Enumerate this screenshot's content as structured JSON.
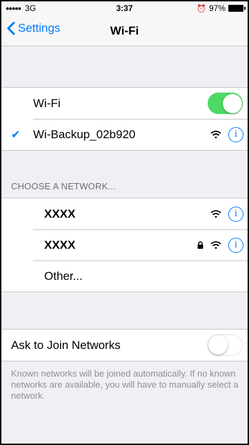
{
  "status_bar": {
    "signal": "●●●●●",
    "carrier": "3G",
    "time": "3:37",
    "battery": "97%",
    "alarm_icon": "alarm-icon"
  },
  "nav": {
    "back_label": "Settings",
    "title": "Wi-Fi"
  },
  "wifi_group": {
    "toggle_label": "Wi-Fi",
    "toggle_on": true,
    "connected_network": "Wi-Backup_02b920"
  },
  "networks": {
    "header": "CHOOSE A NETWORK...",
    "items": [
      {
        "name": "XXXX",
        "locked": false
      },
      {
        "name": "XXXX",
        "locked": true
      }
    ],
    "other_label": "Other..."
  },
  "ask_join": {
    "label": "Ask to Join Networks",
    "toggle_on": false,
    "footer": "Known networks will be joined automatically. If no known networks are available, you will have to manually select a network."
  },
  "colors": {
    "accent": "#007aff",
    "toggle_on": "#4cd964",
    "background": "#efeff4"
  }
}
